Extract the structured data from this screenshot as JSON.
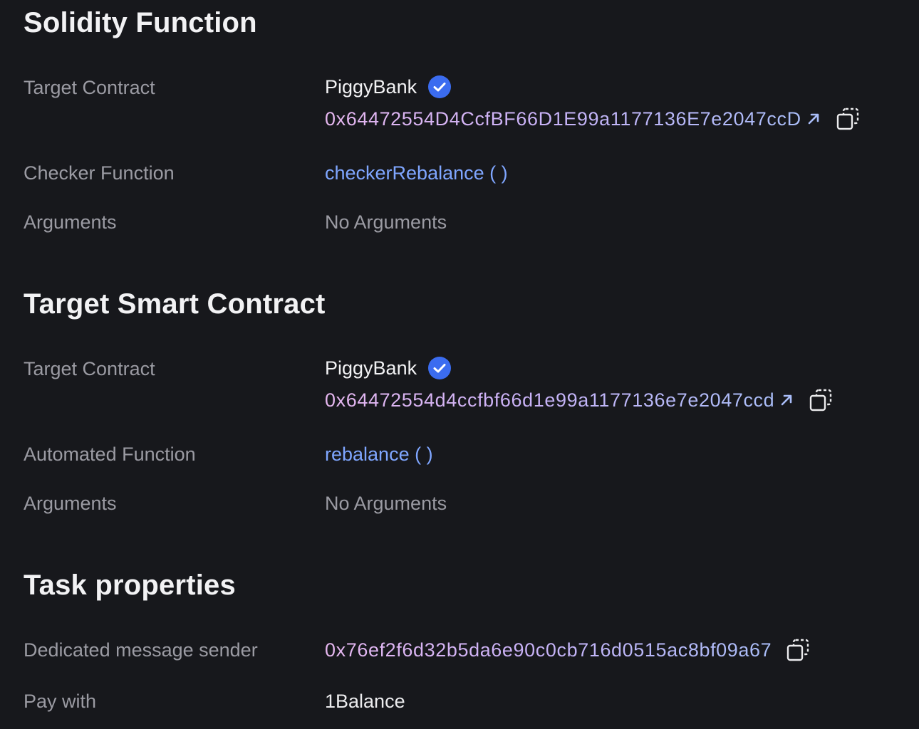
{
  "sections": {
    "solidity": {
      "title": "Solidity Function",
      "target_contract_label": "Target Contract",
      "contract_name": "PiggyBank",
      "contract_address": "0x64472554D4CcfBF66D1E99a1177136E7e2047ccD",
      "checker_label": "Checker Function",
      "checker_value": "checkerRebalance ( )",
      "arguments_label": "Arguments",
      "arguments_value": "No Arguments"
    },
    "target": {
      "title": "Target Smart Contract",
      "target_contract_label": "Target Contract",
      "contract_name": "PiggyBank",
      "contract_address": "0x64472554d4ccfbf66d1e99a1177136e7e2047ccd",
      "automated_label": "Automated Function",
      "automated_value": "rebalance ( )",
      "arguments_label": "Arguments",
      "arguments_value": "No Arguments"
    },
    "task": {
      "title": "Task properties",
      "sender_label": "Dedicated message sender",
      "sender_value": "0x76ef2f6d32b5da6e90c0cb716d0515ac8bf09a67",
      "pay_label": "Pay with",
      "pay_value": "1Balance"
    }
  },
  "icons": {
    "verified": "verified-check-icon",
    "external_link": "external-link-icon",
    "copy": "copy-icon"
  },
  "colors": {
    "background": "#17181c",
    "verified_badge": "#3b6cf0",
    "function_link": "#7fa6ff",
    "label": "#9b9ba3"
  }
}
